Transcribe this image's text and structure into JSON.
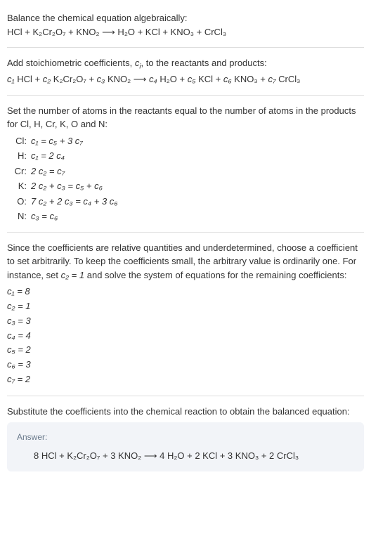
{
  "intro": {
    "line1": "Balance the chemical equation algebraically:",
    "equation": "HCl + K₂Cr₂O₇ + KNO₂  ⟶  H₂O + KCl + KNO₃ + CrCl₃"
  },
  "stoich": {
    "line1_a": "Add stoichiometric coefficients, ",
    "line1_ci": "c",
    "line1_isub": "i",
    "line1_b": ", to the reactants and products:",
    "equation_parts": {
      "c1": "c₁",
      "r1": " HCl + ",
      "c2": "c₂",
      "r2": " K₂Cr₂O₇ + ",
      "c3": "c₃",
      "r3": " KNO₂  ⟶  ",
      "c4": "c₄",
      "r4": " H₂O + ",
      "c5": "c₅",
      "r5": " KCl + ",
      "c6": "c₆",
      "r6": " KNO₃ + ",
      "c7": "c₇",
      "r7": " CrCl₃"
    }
  },
  "atoms": {
    "heading": "Set the number of atoms in the reactants equal to the number of atoms in the products for Cl, H, Cr, K, O and N:",
    "rows": [
      {
        "elem": "Cl:",
        "eq": "c₁ = c₅ + 3 c₇"
      },
      {
        "elem": "H:",
        "eq": "c₁ = 2 c₄"
      },
      {
        "elem": "Cr:",
        "eq": "2 c₂ = c₇"
      },
      {
        "elem": "K:",
        "eq": "2 c₂ + c₃ = c₅ + c₆"
      },
      {
        "elem": "O:",
        "eq": "7 c₂ + 2 c₃ = c₄ + 3 c₆"
      },
      {
        "elem": "N:",
        "eq": "c₃ = c₆"
      }
    ]
  },
  "solve": {
    "text_a": "Since the coefficients are relative quantities and underdetermined, choose a coefficient to set arbitrarily. To keep the coefficients small, the arbitrary value is ordinarily one. For instance, set ",
    "c2eq": "c₂ = 1",
    "text_b": " and solve the system of equations for the remaining coefficients:",
    "coeffs": [
      "c₁ = 8",
      "c₂ = 1",
      "c₃ = 3",
      "c₄ = 4",
      "c₅ = 2",
      "c₆ = 3",
      "c₇ = 2"
    ]
  },
  "substitute": {
    "text": "Substitute the coefficients into the chemical reaction to obtain the balanced equation:"
  },
  "answer": {
    "label": "Answer:",
    "equation": "8 HCl + K₂Cr₂O₇ + 3 KNO₂  ⟶  4 H₂O + 2 KCl + 3 KNO₃ + 2 CrCl₃"
  }
}
